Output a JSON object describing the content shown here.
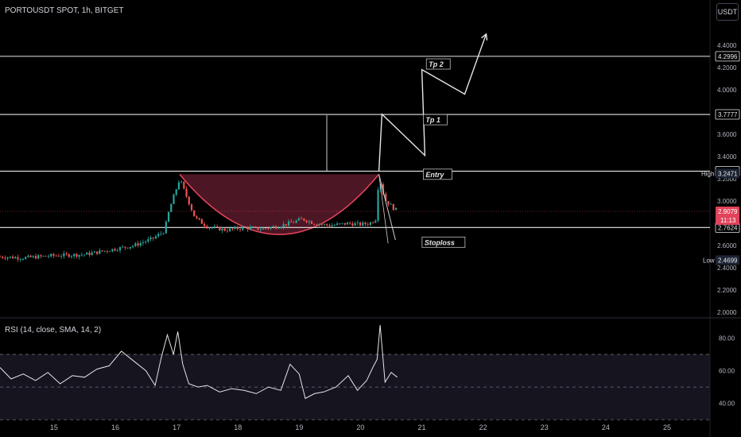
{
  "header": {
    "symbol_title": "PORTOUSDT SPOT, 1h, BITGET",
    "currency_button": "USDT"
  },
  "colors": {
    "background": "#000000",
    "text": "#d1d4dc",
    "up_candle": "#26a69a",
    "down_candle": "#ef5350",
    "cup_fill": "#5a1a2a",
    "cup_arc": "#e0435a",
    "current_price_badge": "#e0435a",
    "high_low_badge": "#1c2434",
    "rsi_band": "#16141f"
  },
  "chart_data": [
    {
      "type": "candlestick",
      "title": "PORTOUSDT SPOT, 1h, BITGET",
      "x_tick_labels": [
        "15",
        "16",
        "17",
        "18",
        "19",
        "20",
        "21",
        "22",
        "23",
        "24",
        "25"
      ],
      "y_tick_labels": [
        "4.4000",
        "4.2000",
        "4.0000",
        "3.8000",
        "3.6000",
        "3.4000",
        "3.2000",
        "3.0000",
        "2.8000",
        "2.6000",
        "2.4000",
        "2.2000",
        "2.0000"
      ],
      "ylim": [
        1.98,
        4.47
      ],
      "xlim": [
        14.12,
        25.7
      ],
      "horizontal_levels": [
        4.2996,
        3.7777,
        3.268,
        2.7624
      ],
      "labels": {
        "high_label": "High",
        "high_value": "3.2471",
        "low_label": "Low",
        "low_value": "2.4699",
        "current_price": "2.9079",
        "countdown": "11:13",
        "level_values": [
          "4.2996",
          "3.7777",
          "3.2680",
          "2.7624"
        ]
      },
      "annotations": [
        "Tp 2",
        "Tp 1",
        "Entry",
        "Stoploss"
      ],
      "projection_path": [
        [
          20.3,
          3.27
        ],
        [
          20.35,
          3.78
        ],
        [
          21.05,
          3.41
        ],
        [
          21.0,
          4.18
        ],
        [
          21.7,
          3.96
        ],
        [
          22.05,
          4.5
        ]
      ],
      "cup": {
        "start_x": 17.05,
        "end_x": 20.3,
        "rim": 3.24,
        "bottom": 2.7
      },
      "price_series": [
        [
          14.12,
          2.5
        ],
        [
          14.5,
          2.49
        ],
        [
          15.0,
          2.51
        ],
        [
          15.5,
          2.52
        ],
        [
          15.9,
          2.56
        ],
        [
          16.3,
          2.6
        ],
        [
          16.6,
          2.66
        ],
        [
          16.8,
          2.73
        ],
        [
          16.88,
          2.92
        ],
        [
          17.05,
          3.2
        ],
        [
          17.12,
          3.1
        ],
        [
          17.3,
          2.85
        ],
        [
          17.5,
          2.77
        ],
        [
          17.8,
          2.74
        ],
        [
          18.1,
          2.76
        ],
        [
          18.4,
          2.75
        ],
        [
          18.7,
          2.78
        ],
        [
          18.9,
          2.81
        ],
        [
          19.05,
          2.84
        ],
        [
          19.25,
          2.8
        ],
        [
          19.5,
          2.78
        ],
        [
          19.8,
          2.8
        ],
        [
          20.0,
          2.79
        ],
        [
          20.15,
          2.8
        ],
        [
          20.25,
          2.84
        ],
        [
          20.3,
          3.22
        ],
        [
          20.4,
          3.01
        ],
        [
          20.55,
          2.93
        ],
        [
          20.62,
          2.91
        ]
      ]
    },
    {
      "type": "line",
      "title": "RSI (14, close, SMA, 14, 2)",
      "ylim": [
        34,
        90
      ],
      "y_tick_labels": [
        "80.00",
        "60.00",
        "40.00"
      ],
      "bands": [
        70,
        50,
        30
      ],
      "series": [
        {
          "x": [
            14.12,
            14.3,
            14.5,
            14.7,
            14.9,
            15.1,
            15.3,
            15.5,
            15.7,
            15.9,
            16.1,
            16.3,
            16.5,
            16.65,
            16.75,
            16.85,
            16.95,
            17.02,
            17.1,
            17.2,
            17.35,
            17.5,
            17.7,
            17.9,
            18.1,
            18.3,
            18.5,
            18.7,
            18.85,
            19.0,
            19.1,
            19.25,
            19.4,
            19.6,
            19.8,
            19.95,
            20.1,
            20.2,
            20.27,
            20.32,
            20.4,
            20.5,
            20.6
          ],
          "values": [
            62,
            55,
            58,
            54,
            59,
            52,
            57,
            56,
            61,
            63,
            72,
            66,
            60,
            51,
            68,
            82,
            70,
            84,
            64,
            52,
            50,
            51,
            47,
            49,
            48,
            46,
            50,
            48,
            64,
            58,
            43,
            46,
            47,
            50,
            57,
            48,
            54,
            62,
            67,
            88,
            53,
            59,
            56
          ]
        }
      ]
    }
  ]
}
